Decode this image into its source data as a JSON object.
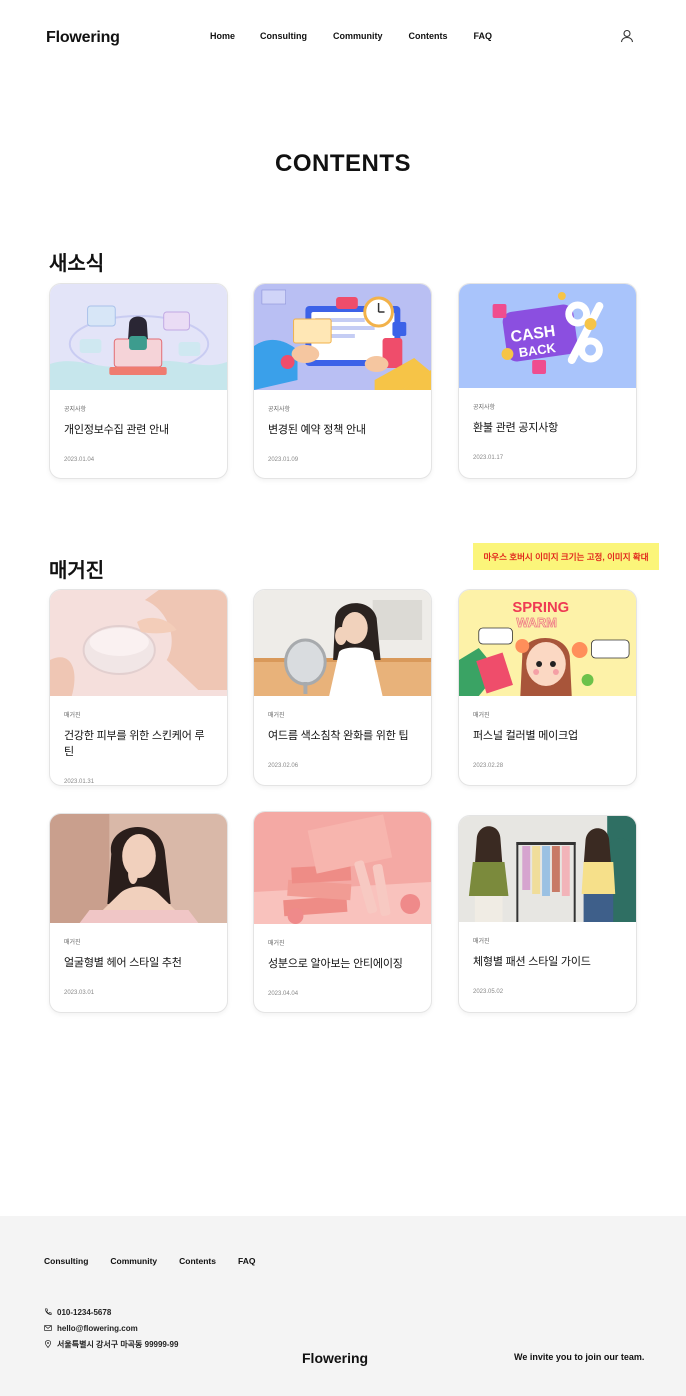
{
  "header": {
    "logo": "Flowering",
    "nav": [
      "Home",
      "Consulting",
      "Community",
      "Contents",
      "FAQ"
    ]
  },
  "page_title": "CONTENTS",
  "sections": [
    {
      "title": "새소식",
      "cards": [
        {
          "category": "공지사항",
          "title": "개인정보수집 관련 안내",
          "date": "2023.01.04",
          "image": "data-privacy-illustration"
        },
        {
          "category": "공지사항",
          "title": "변경된 예약 정책 안내",
          "date": "2023.01.09",
          "image": "reservation-illustration"
        },
        {
          "category": "공지사항",
          "title": "환불 관련 공지사항",
          "date": "2023.01.17",
          "image": "cashback-illustration"
        }
      ]
    },
    {
      "title": "매거진",
      "cards": [
        {
          "category": "매거진",
          "title": "건강한 피부를 위한 스킨케어 루틴",
          "date": "2023.01.31",
          "image": "cream-jar-photo"
        },
        {
          "category": "매거진",
          "title": "여드름 색소침착 완화를 위한 팁",
          "date": "2023.02.06",
          "image": "mirror-woman-photo"
        },
        {
          "category": "매거진",
          "title": "퍼스널 컬러별 메이크업",
          "date": "2023.02.28",
          "image": "spring-warm-illustration"
        },
        {
          "category": "매거진",
          "title": "얼굴형별 헤어 스타일 추천",
          "date": "2023.03.01",
          "image": "woman-portrait-photo"
        },
        {
          "category": "매거진",
          "title": "성분으로 알아보는 안티에이징",
          "date": "2023.04.04",
          "image": "pink-cosmetics-photo"
        },
        {
          "category": "매거진",
          "title": "체형별 패션 스타일 가이드",
          "date": "2023.05.02",
          "image": "fashion-rack-photo"
        }
      ]
    }
  ],
  "image_text": {
    "cash": "CASH",
    "back": "BACK",
    "spring": "SPRING",
    "warm": "WARM"
  },
  "note": "마우스 호버시 이미지 크기는 고정, 이미지 확대",
  "footer": {
    "nav": [
      "Consulting",
      "Community",
      "Contents",
      "FAQ"
    ],
    "phone": "010-1234-5678",
    "email": "hello@flowering.com",
    "address": "서울특별시 강서구 마곡동 99999-99",
    "logo": "Flowering",
    "tagline": "We invite you to join our team."
  },
  "colors": {
    "note_bg": "#fbf57a",
    "note_text": "#e1261c",
    "footer_bg": "#f4f4f4"
  }
}
